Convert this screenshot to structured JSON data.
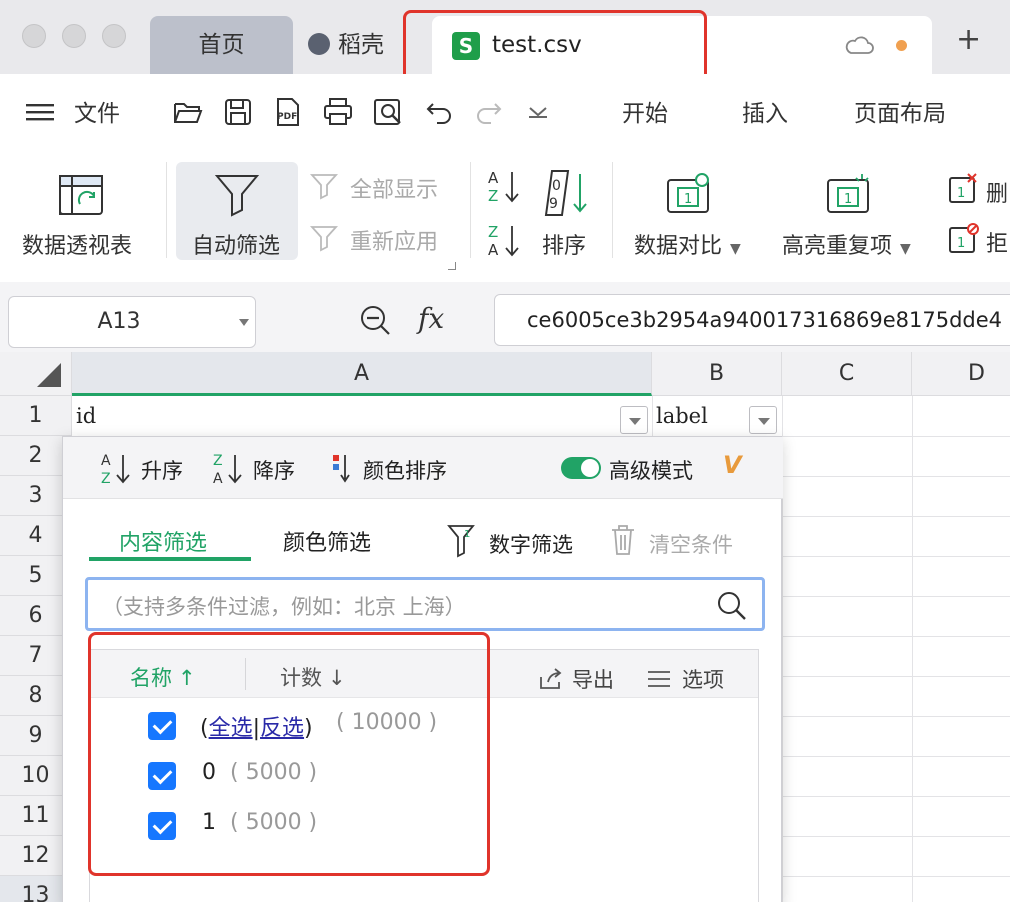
{
  "tabs": {
    "home": "首页",
    "daoke": "稻壳",
    "active": "test.csv",
    "new_tab": "+"
  },
  "menu": {
    "file": "文件",
    "start": "开始",
    "insert": "插入",
    "page_layout": "页面布局"
  },
  "ribbon": {
    "pivot": "数据透视表",
    "auto_filter": "自动筛选",
    "show_all": "全部显示",
    "reapply": "重新应用",
    "sort": "排序",
    "data_compare": "数据对比",
    "highlight_dup": "高亮重复项",
    "delete_partial": "删",
    "reject_partial": "拒"
  },
  "formula_bar": {
    "name_box": "A13",
    "fx": "fx",
    "content": "ce6005ce3b2954a940017316869e8175dde4"
  },
  "grid": {
    "columns": [
      "A",
      "B",
      "C",
      "D"
    ],
    "rows": [
      "1",
      "2",
      "3",
      "4",
      "5",
      "6",
      "7",
      "8",
      "9",
      "10",
      "11",
      "12",
      "13"
    ],
    "A1": "id",
    "B1": "label"
  },
  "filter_popup": {
    "asc": "升序",
    "desc": "降序",
    "color_sort": "颜色排序",
    "advanced_mode": "高级模式",
    "vip_badge": "V",
    "content_filter": "内容筛选",
    "color_filter": "颜色筛选",
    "number_filter": "数字筛选",
    "clear_condition": "清空条件",
    "search_placeholder": "（支持多条件过滤，例如：北京  上海）",
    "col_name": "名称",
    "col_name_arrow": "↑",
    "col_count": "计数",
    "col_count_arrow": "↓",
    "export": "导出",
    "options": "选项",
    "items": [
      {
        "open": "(",
        "select_all": "全选",
        "sep": "|",
        "invert": "反选",
        "close": ")",
        "count": "( 10000 )",
        "checked": true
      },
      {
        "label": "0",
        "count": "( 5000 )",
        "checked": true
      },
      {
        "label": "1",
        "count": "( 5000 )",
        "checked": true
      }
    ]
  },
  "colors": {
    "accent_green": "#21a366",
    "highlight_red": "#e0342b",
    "checkbox_blue": "#1677ff"
  }
}
